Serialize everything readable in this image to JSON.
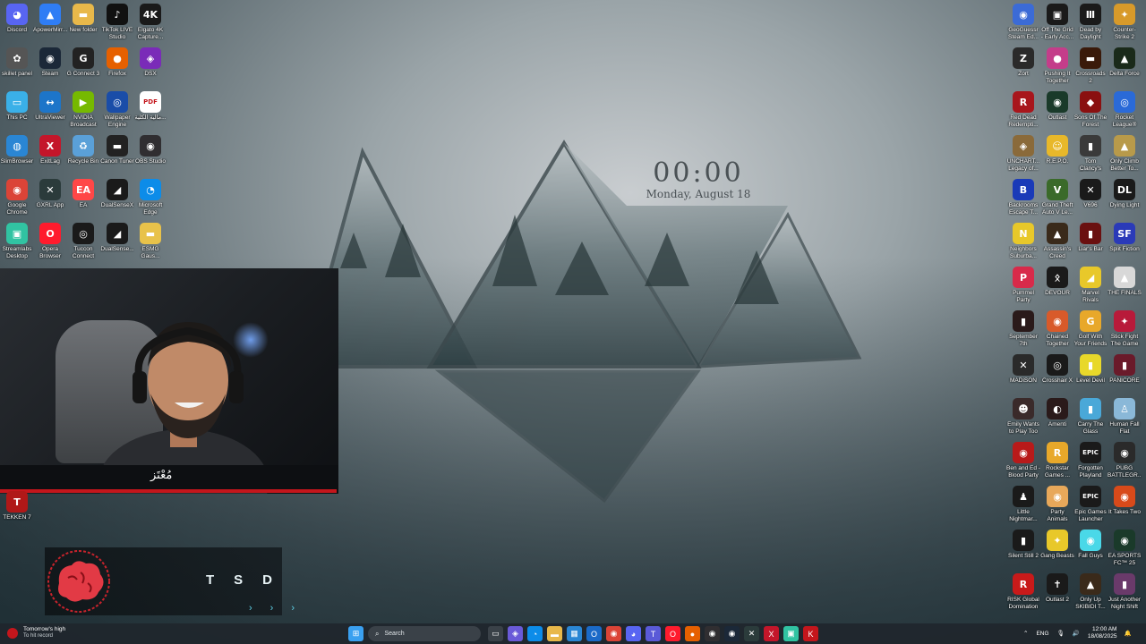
{
  "clock": {
    "time": "00:00",
    "date": "Monday, August 18"
  },
  "left_icons": [
    {
      "label": "Discord",
      "icon": "discord-icon",
      "color": "#5865f2",
      "glyph": "◕"
    },
    {
      "label": "ApowerMirr...",
      "icon": "apowermirror-icon",
      "color": "#2f7df5",
      "glyph": "▲"
    },
    {
      "label": "New folder",
      "icon": "folder-icon",
      "color": "#e8b84a",
      "glyph": "▬"
    },
    {
      "label": "TikTok LIVE Studio",
      "icon": "tiktok-icon",
      "color": "#111111",
      "glyph": "♪"
    },
    {
      "label": "Elgato 4K Capture...",
      "icon": "elgato-icon",
      "color": "#1a1a1a",
      "glyph": "4K"
    },
    {
      "label": "skillet panel",
      "icon": "skillet-icon",
      "color": "#555555",
      "glyph": "✿"
    },
    {
      "label": "Steam",
      "icon": "steam-icon",
      "color": "#1b2838",
      "glyph": "◉"
    },
    {
      "label": "G Connect 3",
      "icon": "gconnect-icon",
      "color": "#222222",
      "glyph": "G"
    },
    {
      "label": "Firefox",
      "icon": "firefox-icon",
      "color": "#e66000",
      "glyph": "●"
    },
    {
      "label": "DSX",
      "icon": "dsx-icon",
      "color": "#7a2bb8",
      "glyph": "◈"
    },
    {
      "label": "This PC",
      "icon": "this-pc-icon",
      "color": "#3ab0e8",
      "glyph": "▭"
    },
    {
      "label": "UltraViewer",
      "icon": "ultraviewer-icon",
      "color": "#1d75c9",
      "glyph": "↔"
    },
    {
      "label": "NVIDIA Broadcast",
      "icon": "nvidia-icon",
      "color": "#76b900",
      "glyph": "▶"
    },
    {
      "label": "Wallpaper Engine",
      "icon": "wallpaper-engine-icon",
      "color": "#1a4da8",
      "glyph": "◎"
    },
    {
      "label": "مالية الكلية...",
      "icon": "pdf-icon",
      "color": "#ffffff",
      "glyph": "PDF"
    },
    {
      "label": "SlimBrowser",
      "icon": "slimbrowser-icon",
      "color": "#2a86d4",
      "glyph": "◍"
    },
    {
      "label": "ExitLag",
      "icon": "exitlag-icon",
      "color": "#c4162a",
      "glyph": "X"
    },
    {
      "label": "Recycle Bin",
      "icon": "recycle-bin-icon",
      "color": "#5aa0d8",
      "glyph": "♻"
    },
    {
      "label": "Canon Tuner",
      "icon": "canon-tuner-icon",
      "color": "#222222",
      "glyph": "▬"
    },
    {
      "label": "OBS Studio",
      "icon": "obs-icon",
      "color": "#302e31",
      "glyph": "◉"
    },
    {
      "label": "Google Chrome",
      "icon": "chrome-icon",
      "color": "#db4437",
      "glyph": "◉"
    },
    {
      "label": "GXRL App",
      "icon": "gxrl-icon",
      "color": "#2b3b3b",
      "glyph": "✕"
    },
    {
      "label": "EA",
      "icon": "ea-icon",
      "color": "#ff4747",
      "glyph": "EA"
    },
    {
      "label": "DualSenseX",
      "icon": "dualsensex-icon",
      "color": "#1a1a1a",
      "glyph": "◢"
    },
    {
      "label": "Microsoft Edge",
      "icon": "edge-icon",
      "color": "#0c8ce9",
      "glyph": "◔"
    },
    {
      "label": "Streamlabs Desktop",
      "icon": "streamlabs-icon",
      "color": "#31c3a2",
      "glyph": "▣"
    },
    {
      "label": "Opera Browser",
      "icon": "opera-icon",
      "color": "#ff1b2d",
      "glyph": "O"
    },
    {
      "label": "Tuccon Connect",
      "icon": "tuccon-icon",
      "color": "#1a1a1a",
      "glyph": "◎"
    },
    {
      "label": "DualSense...",
      "icon": "dualsense-icon",
      "color": "#1a1a1a",
      "glyph": "◢"
    },
    {
      "label": "ESMG Gaus...",
      "icon": "esmg-folder-icon",
      "color": "#e8c24a",
      "glyph": "▬"
    }
  ],
  "tekken": {
    "label": "TEKKEN 7",
    "icon": "tekken-icon",
    "color": "#b01818",
    "glyph": "T"
  },
  "right_icons": [
    {
      "label": "GeoGuessr Steam Ed...",
      "icon": "geoguessr-icon",
      "color": "#3b6bd6",
      "glyph": "◉"
    },
    {
      "label": "Off The Grid - Early Acc...",
      "icon": "off-the-grid-icon",
      "color": "#1a1a1a",
      "glyph": "▣"
    },
    {
      "label": "Dead by Daylight",
      "icon": "dead-by-daylight-icon",
      "color": "#1a1a1a",
      "glyph": "Ⅲ"
    },
    {
      "label": "Counter-Strike 2",
      "icon": "cs2-icon",
      "color": "#d89a2a",
      "glyph": "✦"
    },
    {
      "label": "Zort",
      "icon": "zort-icon",
      "color": "#2a2a2a",
      "glyph": "Z"
    },
    {
      "label": "Pushing It Together",
      "icon": "pushing-it-together-icon",
      "color": "#c43d8a",
      "glyph": "●"
    },
    {
      "label": "Crossroads 2",
      "icon": "crossroads-icon",
      "color": "#3a1a0a",
      "glyph": "▬"
    },
    {
      "label": "Delta Force",
      "icon": "delta-force-icon",
      "color": "#1a2a1a",
      "glyph": "▲"
    },
    {
      "label": "Red Dead Redempti...",
      "icon": "red-dead-icon",
      "color": "#a8161c",
      "glyph": "R"
    },
    {
      "label": "Outlast",
      "icon": "outlast-icon",
      "color": "#1a3a2a",
      "glyph": "◉"
    },
    {
      "label": "Sons Of The Forest",
      "icon": "sons-of-the-forest-icon",
      "color": "#8a1010",
      "glyph": "◆"
    },
    {
      "label": "Rocket League®",
      "icon": "rocket-league-icon",
      "color": "#2a6ad8",
      "glyph": "◎"
    },
    {
      "label": "UNCHART... Legacy of...",
      "icon": "uncharted-icon",
      "color": "#8a6a3a",
      "glyph": "◈"
    },
    {
      "label": "R.E.P.O.",
      "icon": "repo-icon",
      "color": "#e8b82a",
      "glyph": "☺"
    },
    {
      "label": "Tom Clancy's Rainbow Si...",
      "icon": "rainbow-six-icon",
      "color": "#3a3a3a",
      "glyph": "▮"
    },
    {
      "label": "Only Climb Better To...",
      "icon": "only-climb-icon",
      "color": "#b89a4a",
      "glyph": "▲"
    },
    {
      "label": "Backrooms Escape T...",
      "icon": "backrooms-icon",
      "color": "#1a3ab8",
      "glyph": "B"
    },
    {
      "label": "Grand Theft Auto V Le...",
      "icon": "gta-v-icon",
      "color": "#3a6a2a",
      "glyph": "V"
    },
    {
      "label": "V696",
      "icon": "v696-icon",
      "color": "#1a1a1a",
      "glyph": "✕"
    },
    {
      "label": "Dying Light",
      "icon": "dying-light-icon",
      "color": "#1a1a1a",
      "glyph": "DL"
    },
    {
      "label": "Neighbors Suburba...",
      "icon": "neighbors-icon",
      "color": "#e8c82a",
      "glyph": "N"
    },
    {
      "label": "Assassin's Creed Mirage",
      "icon": "ac-mirage-icon",
      "color": "#3a2a1a",
      "glyph": "▲"
    },
    {
      "label": "Liar's Bar",
      "icon": "liars-bar-icon",
      "color": "#6a1010",
      "glyph": "▮"
    },
    {
      "label": "Split Fiction",
      "icon": "split-fiction-icon",
      "color": "#2a3ab8",
      "glyph": "SF"
    },
    {
      "label": "Pummel Party",
      "icon": "pummel-party-icon",
      "color": "#d82a4a",
      "glyph": "P"
    },
    {
      "label": "DEVOUR",
      "icon": "devour-icon",
      "color": "#1a1a1a",
      "glyph": "ᛟ"
    },
    {
      "label": "Marvel Rivals",
      "icon": "marvel-rivals-icon",
      "color": "#e8c82a",
      "glyph": "◢"
    },
    {
      "label": "THE FINALS",
      "icon": "the-finals-icon",
      "color": "#d8d8d8",
      "glyph": "▲"
    },
    {
      "label": "September 7th",
      "icon": "september-7th-icon",
      "color": "#2a1a1a",
      "glyph": "▮"
    },
    {
      "label": "Chained Together",
      "icon": "chained-together-icon",
      "color": "#d85a2a",
      "glyph": "◉"
    },
    {
      "label": "Golf With Your Friends",
      "icon": "golf-icon",
      "color": "#e8a82a",
      "glyph": "G"
    },
    {
      "label": "Stick Fight The Game",
      "icon": "stick-fight-icon",
      "color": "#b81a3a",
      "glyph": "✦"
    },
    {
      "label": "MADiSON",
      "icon": "madison-icon",
      "color": "#2a2a2a",
      "glyph": "✕"
    },
    {
      "label": "Crosshair X",
      "icon": "crosshair-x-icon",
      "color": "#1a1a1a",
      "glyph": "◎"
    },
    {
      "label": "Level Devil",
      "icon": "level-devil-icon",
      "color": "#e8d82a",
      "glyph": "▮"
    },
    {
      "label": "PANICORE",
      "icon": "panicore-icon",
      "color": "#6a1a2a",
      "glyph": "▮"
    },
    {
      "label": "Emily Wants to Play Too",
      "icon": "emily-icon",
      "color": "#3a2a2a",
      "glyph": "☻"
    },
    {
      "label": "Amenti",
      "icon": "amenti-icon",
      "color": "#2a1a1a",
      "glyph": "◐"
    },
    {
      "label": "Carry The Glass",
      "icon": "carry-the-glass-icon",
      "color": "#4aa8d8",
      "glyph": "▮"
    },
    {
      "label": "Human Fall Flat",
      "icon": "human-fall-flat-icon",
      "color": "#8ab8d8",
      "glyph": "♙"
    },
    {
      "label": "Ben and Ed - Blood Party",
      "icon": "ben-and-ed-icon",
      "color": "#b81a1a",
      "glyph": "◉"
    },
    {
      "label": "Rockstar Games ...",
      "icon": "rockstar-icon",
      "color": "#e8a82a",
      "glyph": "R"
    },
    {
      "label": "Forgotten Playland",
      "icon": "forgotten-playland-icon",
      "color": "#1a1a1a",
      "glyph": "EPIC"
    },
    {
      "label": "PUBG BATTLEGR...",
      "icon": "pubg-icon",
      "color": "#2a2a2a",
      "glyph": "◉"
    },
    {
      "label": "Little Nightmar...",
      "icon": "little-nightmares-icon",
      "color": "#1a1a1a",
      "glyph": "♟"
    },
    {
      "label": "Party Animals",
      "icon": "party-animals-icon",
      "color": "#e8a85a",
      "glyph": "◉"
    },
    {
      "label": "Epic Games Launcher",
      "icon": "epic-games-icon",
      "color": "#1a1a1a",
      "glyph": "EPIC"
    },
    {
      "label": "It Takes Two",
      "icon": "it-takes-two-icon",
      "color": "#d84a1a",
      "glyph": "◉"
    },
    {
      "label": "Silent Still 2",
      "icon": "silent-still-icon",
      "color": "#1a1a1a",
      "glyph": "▮"
    },
    {
      "label": "Gang Beasts",
      "icon": "gang-beasts-icon",
      "color": "#e8c82a",
      "glyph": "✦"
    },
    {
      "label": "Fall Guys",
      "icon": "fall-guys-icon",
      "color": "#4ad8e8",
      "glyph": "◉"
    },
    {
      "label": "EA SPORTS FC™ 25",
      "icon": "ea-fc-icon",
      "color": "#1a3a2a",
      "glyph": "◉"
    },
    {
      "label": "RISK Global Domination",
      "icon": "risk-icon",
      "color": "#c81a1a",
      "glyph": "R"
    },
    {
      "label": "Outlast 2",
      "icon": "outlast-2-icon",
      "color": "#1a1a1a",
      "glyph": "✝"
    },
    {
      "label": "Only Up SKIBIDI T...",
      "icon": "only-up-icon",
      "color": "#3a2a1a",
      "glyph": "▲"
    },
    {
      "label": "Just Another Night Shift",
      "icon": "night-shift-icon",
      "color": "#6a3a6a",
      "glyph": "▮"
    }
  ],
  "webcam": {
    "signature": "مُعْتَز"
  },
  "team": {
    "letters": "TSD",
    "arrows": "›››"
  },
  "taskbar": {
    "weather_title": "Tomorrow's high",
    "weather_sub": "To hit record",
    "search_placeholder": "Search",
    "lang": "ENG",
    "time": "12:00 AM",
    "date": "18/08/2025",
    "apps": [
      {
        "icon": "windows-start-icon",
        "color": "#3aa0f0",
        "glyph": "⊞"
      },
      {
        "icon": "task-view-icon",
        "color": "#3a4148",
        "glyph": "▭"
      },
      {
        "icon": "copilot-icon",
        "color": "#6a5ad8",
        "glyph": "◈"
      },
      {
        "icon": "edge-taskbar-icon",
        "color": "#0c8ce9",
        "glyph": "◔"
      },
      {
        "icon": "file-explorer-icon",
        "color": "#e8b84a",
        "glyph": "▬"
      },
      {
        "icon": "store-icon",
        "color": "#2a86d4",
        "glyph": "▦"
      },
      {
        "icon": "outlook-icon",
        "color": "#1a6ac8",
        "glyph": "O"
      },
      {
        "icon": "chrome-taskbar-icon",
        "color": "#db4437",
        "glyph": "◉"
      },
      {
        "icon": "discord-taskbar-icon",
        "color": "#5865f2",
        "glyph": "◕"
      },
      {
        "icon": "teams-icon",
        "color": "#5a5ad8",
        "glyph": "T"
      },
      {
        "icon": "opera-taskbar-icon",
        "color": "#ff1b2d",
        "glyph": "O"
      },
      {
        "icon": "firefox-taskbar-icon",
        "color": "#e66000",
        "glyph": "●"
      },
      {
        "icon": "obs-taskbar-icon",
        "color": "#302e31",
        "glyph": "◉"
      },
      {
        "icon": "steam-taskbar-icon",
        "color": "#1b2838",
        "glyph": "◉"
      },
      {
        "icon": "gxrl-taskbar-icon",
        "color": "#2b3b3b",
        "glyph": "✕"
      },
      {
        "icon": "exitlag-taskbar-icon",
        "color": "#c4162a",
        "glyph": "X"
      },
      {
        "icon": "streamlabs-taskbar-icon",
        "color": "#31c3a2",
        "glyph": "▣"
      },
      {
        "icon": "kick-icon",
        "color": "#c4161c",
        "glyph": "K"
      }
    ]
  }
}
